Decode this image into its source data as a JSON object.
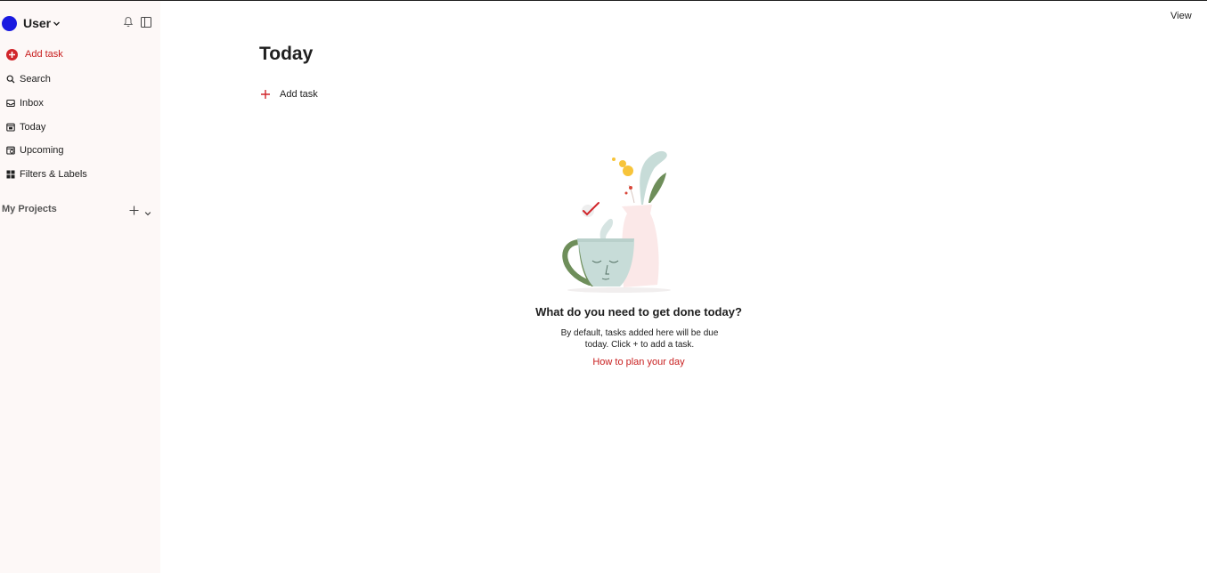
{
  "sidebar": {
    "user": {
      "name": "User",
      "avatar_color": "#1a1ae0"
    },
    "add_task_label": "Add task",
    "items": [
      {
        "label": "Search",
        "icon": "search-icon"
      },
      {
        "label": "Inbox",
        "icon": "inbox-icon"
      },
      {
        "label": "Today",
        "icon": "calendar-today-icon"
      },
      {
        "label": "Upcoming",
        "icon": "calendar-upcoming-icon"
      },
      {
        "label": "Filters & Labels",
        "icon": "grid-icon"
      }
    ],
    "projects_label": "My Projects"
  },
  "header": {
    "view_label": "View"
  },
  "main": {
    "title": "Today",
    "add_task_label": "Add task",
    "empty_state": {
      "title": "What do you need to get done today?",
      "description": "By default, tasks added here will be due today. Click + to add a task.",
      "link": "How to plan your day"
    }
  },
  "colors": {
    "accent": "#d1262b",
    "sidebar_bg": "#fdf8f7"
  }
}
